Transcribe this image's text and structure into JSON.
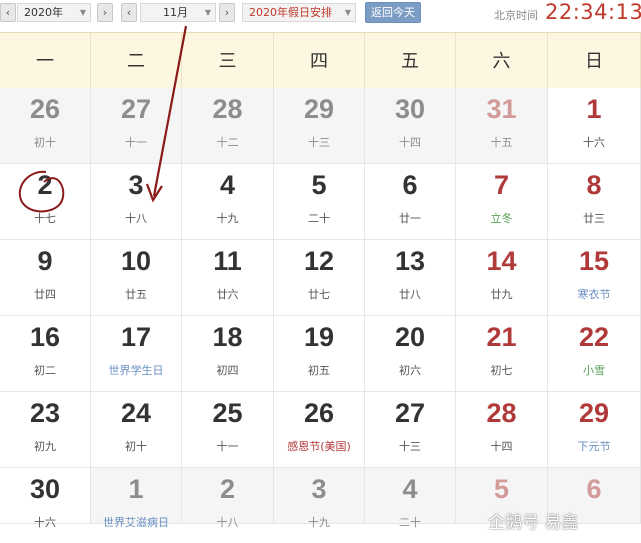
{
  "toolbar": {
    "year": "2020年",
    "month": "11月",
    "holiday": "2020年假日安排",
    "today": "返回今天",
    "beijing_label": "北京时间",
    "time": "22:34:13"
  },
  "weekdays": [
    "一",
    "二",
    "三",
    "四",
    "五",
    "六",
    "日"
  ],
  "weeks": [
    [
      {
        "num": "26",
        "sub": "初十",
        "other": true
      },
      {
        "num": "27",
        "sub": "十一",
        "other": true
      },
      {
        "num": "28",
        "sub": "十二",
        "other": true
      },
      {
        "num": "29",
        "sub": "十三",
        "other": true
      },
      {
        "num": "30",
        "sub": "十四",
        "other": true
      },
      {
        "num": "31",
        "sub": "十五",
        "other": true
      },
      {
        "num": "1",
        "sub": "十六",
        "other": false
      }
    ],
    [
      {
        "num": "2",
        "sub": "十七",
        "other": false
      },
      {
        "num": "3",
        "sub": "十八",
        "other": false
      },
      {
        "num": "4",
        "sub": "十九",
        "other": false
      },
      {
        "num": "5",
        "sub": "二十",
        "other": false
      },
      {
        "num": "6",
        "sub": "廿一",
        "other": false
      },
      {
        "num": "7",
        "sub": "立冬",
        "other": false,
        "tag": "green"
      },
      {
        "num": "8",
        "sub": "廿三",
        "other": false
      }
    ],
    [
      {
        "num": "9",
        "sub": "廿四",
        "other": false
      },
      {
        "num": "10",
        "sub": "廿五",
        "other": false
      },
      {
        "num": "11",
        "sub": "廿六",
        "other": false
      },
      {
        "num": "12",
        "sub": "廿七",
        "other": false
      },
      {
        "num": "13",
        "sub": "廿八",
        "other": false
      },
      {
        "num": "14",
        "sub": "廿九",
        "other": false
      },
      {
        "num": "15",
        "sub": "寒衣节",
        "other": false,
        "tag": "blue"
      }
    ],
    [
      {
        "num": "16",
        "sub": "初二",
        "other": false
      },
      {
        "num": "17",
        "sub": "世界学生日",
        "other": false,
        "tag": "blue"
      },
      {
        "num": "18",
        "sub": "初四",
        "other": false
      },
      {
        "num": "19",
        "sub": "初五",
        "other": false
      },
      {
        "num": "20",
        "sub": "初六",
        "other": false
      },
      {
        "num": "21",
        "sub": "初七",
        "other": false
      },
      {
        "num": "22",
        "sub": "小雪",
        "other": false,
        "tag": "green"
      }
    ],
    [
      {
        "num": "23",
        "sub": "初九",
        "other": false
      },
      {
        "num": "24",
        "sub": "初十",
        "other": false
      },
      {
        "num": "25",
        "sub": "十一",
        "other": false
      },
      {
        "num": "26",
        "sub": "感恩节(美国)",
        "other": false,
        "tag": "red"
      },
      {
        "num": "27",
        "sub": "十三",
        "other": false
      },
      {
        "num": "28",
        "sub": "十四",
        "other": false
      },
      {
        "num": "29",
        "sub": "下元节",
        "other": false,
        "tag": "blue"
      }
    ],
    [
      {
        "num": "30",
        "sub": "十六",
        "other": false
      },
      {
        "num": "1",
        "sub": "世界艾滋病日",
        "other": true,
        "tag": "blue"
      },
      {
        "num": "2",
        "sub": "十八",
        "other": true
      },
      {
        "num": "3",
        "sub": "十九",
        "other": true
      },
      {
        "num": "4",
        "sub": "二十",
        "other": true
      },
      {
        "num": "5",
        "sub": "",
        "other": true
      },
      {
        "num": "6",
        "sub": "",
        "other": true
      }
    ]
  ],
  "watermark": "企鹅号 易鑫",
  "colors": {
    "weekend_red": "#b03a3a",
    "header_bg": "#fdf7e2",
    "festival_blue": "#6a8fc3",
    "solar_term_green": "#5aa05a",
    "annotation_dark_red": "#8b1a1a"
  }
}
